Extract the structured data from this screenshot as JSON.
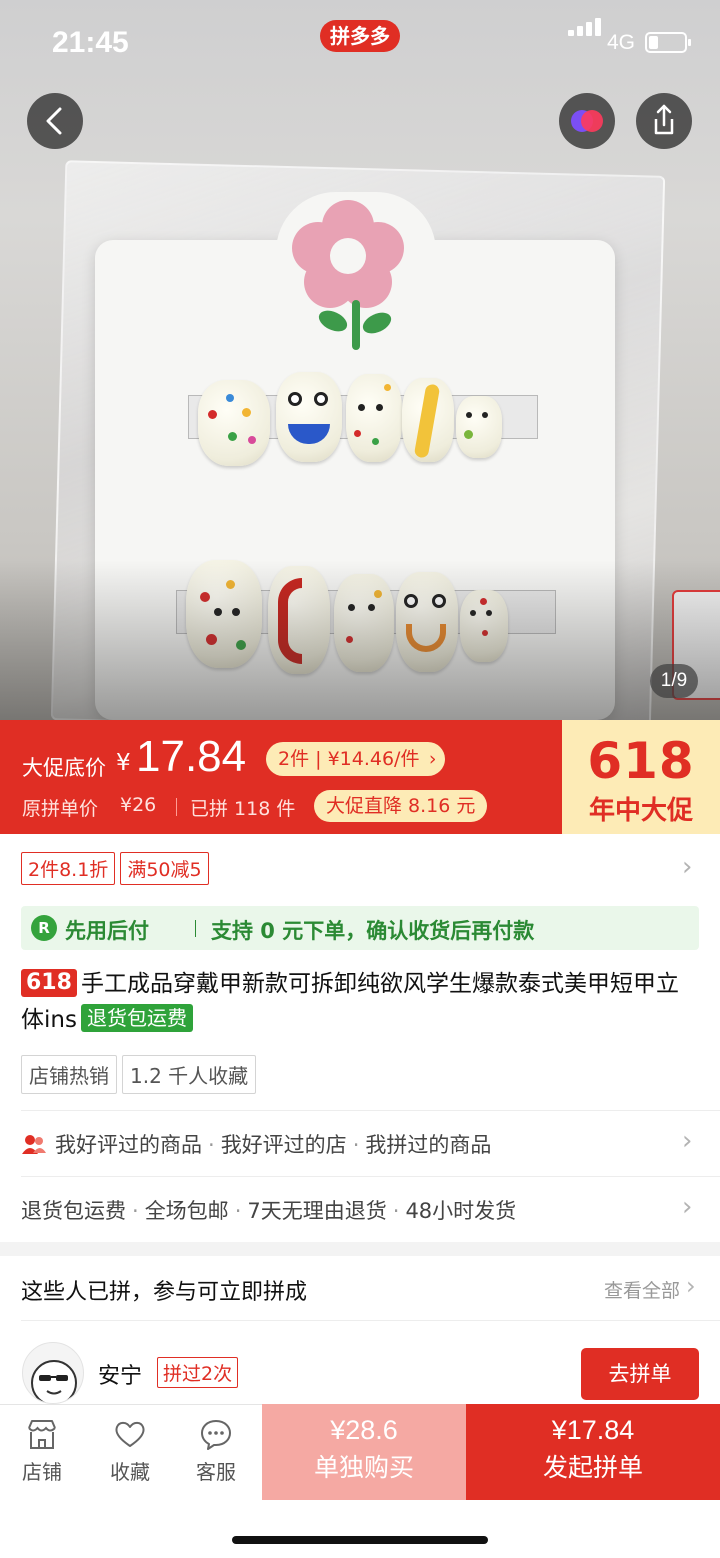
{
  "status_bar": {
    "time": "21:45",
    "network": "4G",
    "app_pill": "拼多多"
  },
  "gallery": {
    "counter": "1/9"
  },
  "price_banner": {
    "label": "大促底价",
    "currency": "¥",
    "price": "17.84",
    "multi_offer": "2件 | ¥14.46/件",
    "orig_label": "原拼单价",
    "orig_price": "¥26",
    "sold": "已拼 118 件",
    "drop": "大促直降 8.16 元",
    "promo_number": "618",
    "promo_text": "年中大促"
  },
  "coupons": [
    "2件8.1折",
    "满50减5"
  ],
  "pay_later": {
    "badge": "R",
    "title": "先用后付",
    "desc": "支持 0 元下单，确认收货后再付款"
  },
  "product": {
    "tag": "618",
    "title": "手工成品穿戴甲新款可拆卸纯欲风学生爆款泰式美甲短甲立体ins",
    "return_tag": "退货包运费",
    "chips": [
      "店铺热销",
      "1.2 千人收藏"
    ]
  },
  "social_row": {
    "items": [
      "我好评过的商品",
      "我好评过的店",
      "我拼过的商品"
    ]
  },
  "service_row": {
    "items": [
      "退货包运费",
      "全场包邮",
      "7天无理由退货",
      "48小时发货"
    ]
  },
  "group": {
    "heading": "这些人已拼，参与可立即拼成",
    "see_all": "查看全部",
    "user_name": "安宁",
    "user_times": "拼过2次",
    "join_label": "去拼单"
  },
  "bottom_nav": {
    "shop": "店铺",
    "favorite": "收藏",
    "service": "客服",
    "solo_price": "¥28.6",
    "solo_label": "单独购买",
    "group_price": "¥17.84",
    "group_label": "发起拼单"
  },
  "colors": {
    "brand_red": "#e02e24",
    "promo_yellow": "#fdebb6",
    "green": "#2fa33a"
  }
}
